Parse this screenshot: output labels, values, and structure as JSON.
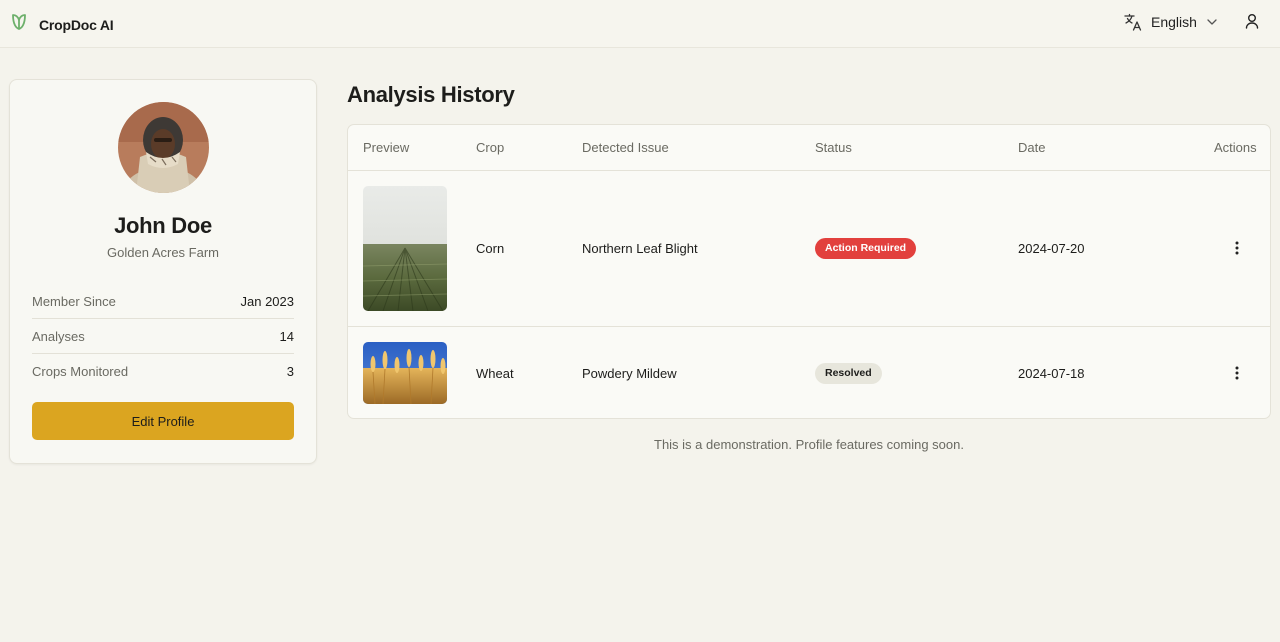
{
  "app": {
    "name": "CropDoc AI",
    "logo_icon": "sprout-icon",
    "accent": "#dba520"
  },
  "header": {
    "language": "English",
    "language_icon": "translate-icon",
    "user_icon": "user-icon"
  },
  "profile": {
    "name": "John Doe",
    "farm": "Golden Acres Farm",
    "stats": [
      {
        "label": "Member Since",
        "value": "Jan 2023"
      },
      {
        "label": "Analyses",
        "value": "14"
      },
      {
        "label": "Crops Monitored",
        "value": "3"
      }
    ],
    "edit_button": "Edit Profile"
  },
  "history": {
    "title": "Analysis History",
    "columns": [
      "Preview",
      "Crop",
      "Detected Issue",
      "Status",
      "Date",
      "Actions"
    ],
    "rows": [
      {
        "crop": "Corn",
        "issue": "Northern Leaf Blight",
        "status": "Action Required",
        "status_color": "#e2403d",
        "date": "2024-07-20"
      },
      {
        "crop": "Wheat",
        "issue": "Powdery Mildew",
        "status": "Resolved",
        "status_color": "#e7e6dc",
        "date": "2024-07-18"
      }
    ]
  },
  "footnote": "This is a demonstration. Profile features coming soon."
}
